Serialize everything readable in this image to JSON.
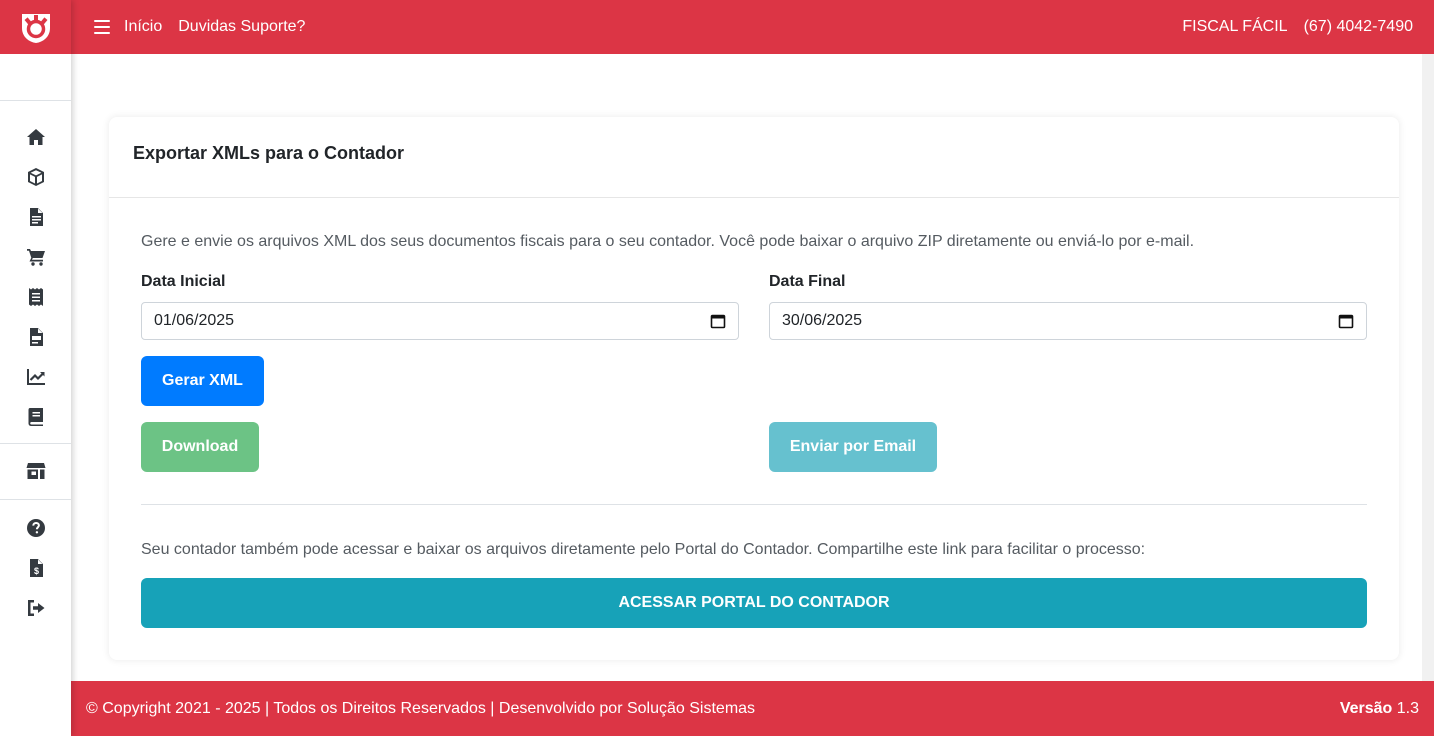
{
  "nav": {
    "home": "Início",
    "support": "Duvidas Suporte?",
    "brand_name": "FISCAL FÁCIL",
    "phone": "(67) 4042-7490"
  },
  "sidebar": {
    "items": [
      {
        "icon": "home-icon"
      },
      {
        "icon": "box-icon"
      },
      {
        "icon": "document-icon"
      },
      {
        "icon": "cart-icon"
      },
      {
        "icon": "receipt-icon"
      },
      {
        "icon": "file-invoice-icon"
      },
      {
        "icon": "chart-line-icon"
      },
      {
        "icon": "book-icon"
      },
      {
        "icon": "store-icon"
      },
      {
        "icon": "help-icon"
      },
      {
        "icon": "file-dollar-icon"
      },
      {
        "icon": "logout-icon"
      }
    ]
  },
  "card": {
    "title": "Exportar XMLs para o Contador",
    "description": "Gere e envie os arquivos XML dos seus documentos fiscais para o seu contador. Você pode baixar o arquivo ZIP diretamente ou enviá-lo por e-mail.",
    "start_label": "Data Inicial",
    "start_value": "01/06/2025",
    "end_label": "Data Final",
    "end_value": "30/06/2025",
    "generate_button": "Gerar XML",
    "download_button": "Download",
    "email_button": "Enviar por Email",
    "portal_description": "Seu contador também pode acessar e baixar os arquivos diretamente pelo Portal do Contador. Compartilhe este link para facilitar o processo:",
    "portal_button": "ACESSAR PORTAL DO CONTADOR"
  },
  "footer": {
    "copyright": "© Copyright 2021 - 2025 | Todos os Direitos Reservados | Desenvolvido por Solução Sistemas",
    "version_label": "Versão",
    "version_value": "1.3"
  },
  "colors": {
    "brand_red": "#dc3545",
    "primary": "#007bff",
    "success_disabled": "#6cc385",
    "info_disabled": "#66c1cf",
    "portal": "#17a2b8"
  }
}
